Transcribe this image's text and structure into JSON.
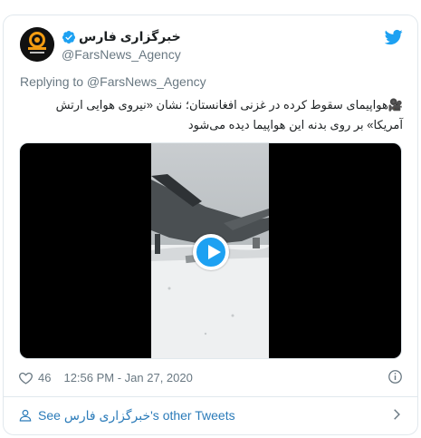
{
  "tweet": {
    "display_name": "خبرگزاری فارس",
    "handle": "@FarsNews_Agency",
    "reply_to": "Replying to @FarsNews_Agency",
    "text": "🎥هواپیمای سقوط کرده در غزنی افغانستان؛ نشان «نیروی هوایی ارتش آمریکا» بر روی بدنه این هواپیما دیده می‌شود",
    "like_count": "46",
    "timestamp": "12:56 PM - Jan 27, 2020",
    "footer_text": "See خبرگزاری فارس's other Tweets"
  },
  "icons": {
    "brand": "twitter-bird-icon",
    "verified": "verified-badge-icon",
    "like": "heart-icon",
    "info": "info-icon",
    "person": "person-icon",
    "chevron": "chevron-right-icon"
  },
  "colors": {
    "twitter_blue": "#1da1f2",
    "link_blue": "#2b7bb9",
    "muted": "#697882",
    "text": "#1c2022",
    "border": "#e1e8ed",
    "avatar_orange": "#f39c12"
  }
}
